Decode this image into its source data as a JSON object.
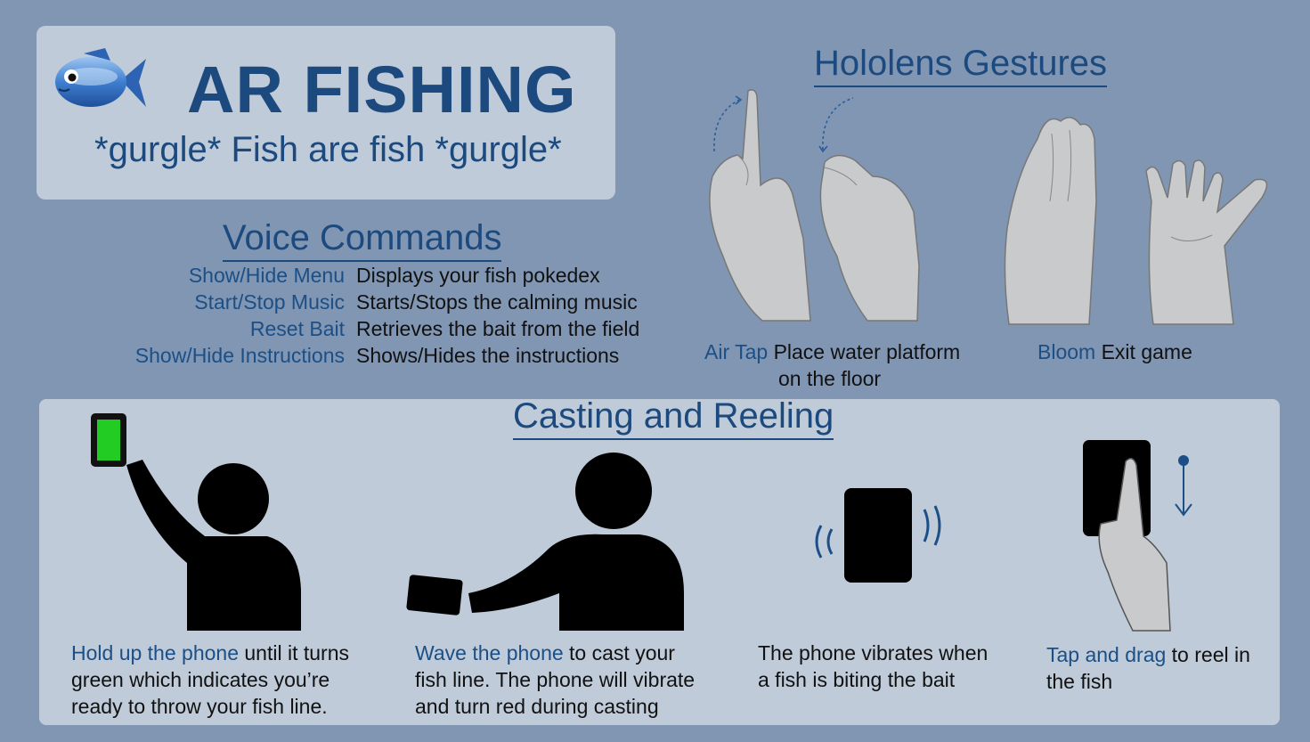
{
  "header": {
    "title": "AR FISHING",
    "subtitle": "*gurgle* Fish are fish *gurgle*",
    "logo_icon": "blue-fish-icon"
  },
  "voice": {
    "heading": "Voice Commands",
    "commands": [
      {
        "command": "Show/Hide Menu",
        "action": "Displays your fish pokedex"
      },
      {
        "command": "Start/Stop Music",
        "action": "Starts/Stops the calming music"
      },
      {
        "command": "Reset Bait",
        "action": "Retrieves the bait from the field"
      },
      {
        "command": "Show/Hide Instructions",
        "action": "Shows/Hides the instructions"
      }
    ]
  },
  "gestures": {
    "heading": "Hololens Gestures",
    "air_tap": {
      "name": "Air Tap",
      "line1": "Place water platform",
      "line2": "on the floor",
      "icon": "air-tap-hands-icon"
    },
    "bloom": {
      "name": "Bloom",
      "desc": "Exit game",
      "icon": "bloom-hands-icon"
    }
  },
  "casting": {
    "heading": "Casting and Reeling",
    "steps": [
      {
        "highlight": "Hold up the phone",
        "line1_rest": " until it turns",
        "line2": "green which indicates you’re",
        "line3": "ready to throw your fish line.",
        "icon": "person-holding-phone-up-icon"
      },
      {
        "highlight": "Wave the phone",
        "line1_rest": " to cast your",
        "line2": "fish line. The phone will vibrate",
        "line3": "and turn red during casting",
        "icon": "person-waving-phone-icon"
      },
      {
        "line1": "The phone vibrates when",
        "line2": "a fish is biting the bait",
        "icon": "vibrating-phone-icon"
      },
      {
        "highlight": "Tap and drag",
        "line1_rest": " to reel in",
        "line2": "the fish",
        "icon": "tap-and-drag-hand-icon"
      }
    ]
  },
  "colors": {
    "background": "#8096b3",
    "panel": "#bfcbd9",
    "accent_blue": "#1c4a7f",
    "phone_ready_green": "#22cc22"
  }
}
